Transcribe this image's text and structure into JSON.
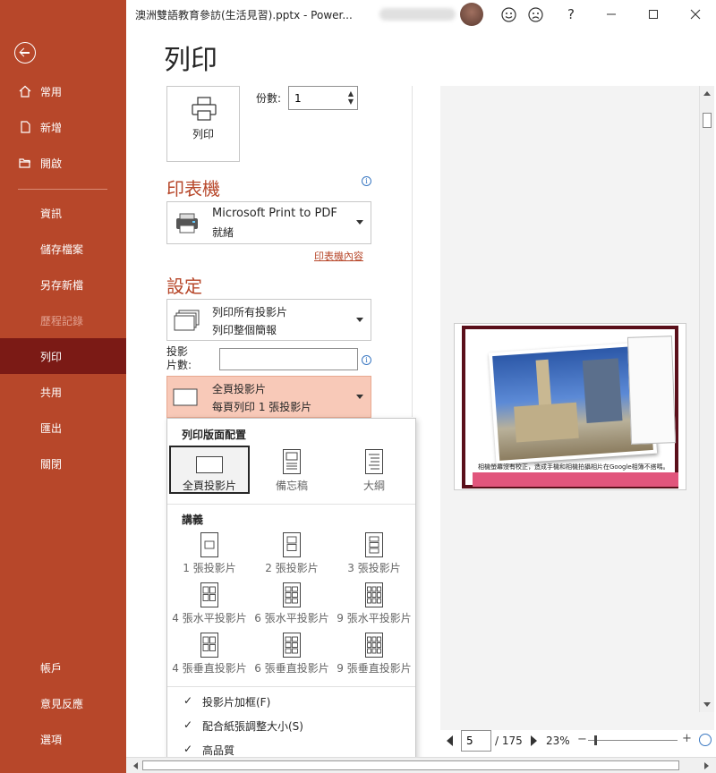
{
  "titlebar": {
    "document": "澳洲雙語教育參訪(生活見習).pptx  -  Power...",
    "help": "?"
  },
  "sidebar": {
    "items": [
      {
        "label": "常用",
        "icon": "home-icon"
      },
      {
        "label": "新增",
        "icon": "new-file-icon"
      },
      {
        "label": "開啟",
        "icon": "open-folder-icon"
      },
      {
        "label": "資訊"
      },
      {
        "label": "儲存檔案"
      },
      {
        "label": "另存新檔"
      },
      {
        "label": "歷程記錄"
      },
      {
        "label": "列印"
      },
      {
        "label": "共用"
      },
      {
        "label": "匯出"
      },
      {
        "label": "關閉"
      },
      {
        "label": "帳戶"
      },
      {
        "label": "意見反應"
      },
      {
        "label": "選項"
      }
    ],
    "selected": "列印"
  },
  "print": {
    "heading": "列印",
    "button_label": "列印",
    "copies_label": "份數:",
    "copies_value": "1"
  },
  "printer": {
    "section_title": "印表機",
    "name": "Microsoft Print to PDF",
    "status": "就緒",
    "properties_link": "印表機內容"
  },
  "settings": {
    "section_title": "設定",
    "range_line1": "列印所有投影片",
    "range_line2": "列印整個簡報",
    "slides_label": "投影片數:",
    "slides_value": "",
    "layout_line1": "全頁投影片",
    "layout_line2": "每頁列印 1 張投影片"
  },
  "layout_panel": {
    "print_layout_header": "列印版面配置",
    "print_layout_options": [
      "全頁投影片",
      "備忘稿",
      "大綱"
    ],
    "handouts_header": "講義",
    "handout_options": [
      "1 張投影片",
      "2 張投影片",
      "3 張投影片",
      "4 張水平投影片",
      "6 張水平投影片",
      "9 張水平投影片",
      "4 張垂直投影片",
      "6 張垂直投影片",
      "9 張垂直投影片"
    ],
    "checks": [
      {
        "label": "投影片加框(F)",
        "checked": true
      },
      {
        "label": "配合紙張調整大小(S)",
        "checked": true
      },
      {
        "label": "高品質",
        "checked": true
      }
    ]
  },
  "preview": {
    "slide_caption": "相機螢幕沒有校正，造成手機和相機拍攝相片在Google相簿不搭嗎。",
    "page_current": "5",
    "page_total": "/ 175",
    "zoom": "23%"
  },
  "colors": {
    "accent": "#b7472a",
    "sidebar_selected": "#7b1a15",
    "highlight": "#f8c9b8"
  }
}
